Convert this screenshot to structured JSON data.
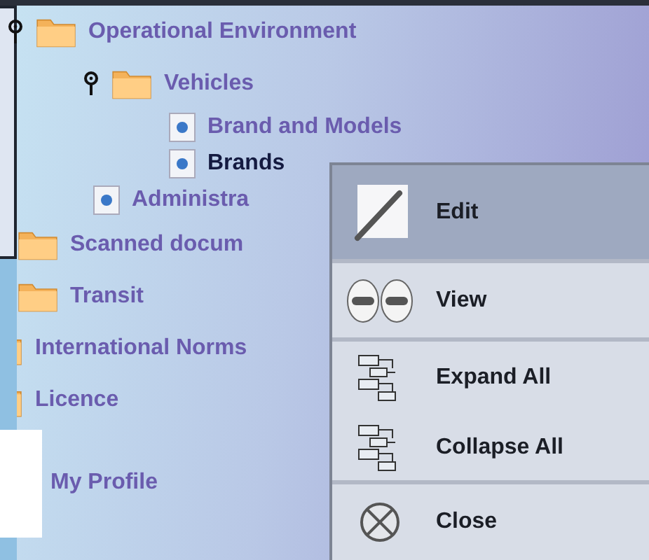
{
  "tree": [
    {
      "label": "Operational Environment",
      "kind": "folder",
      "expanded": true,
      "selected": false,
      "children": [
        {
          "label": "Vehicles",
          "kind": "folder",
          "expanded": true,
          "selected": false,
          "children": [
            {
              "label": "Brand and Models",
              "kind": "document",
              "selected": false
            },
            {
              "label": "Brands",
              "kind": "document",
              "selected": true
            }
          ]
        },
        {
          "label": "Administra",
          "kind": "document",
          "selected": false
        }
      ]
    },
    {
      "label": "Scanned docum",
      "kind": "folder",
      "selected": false
    },
    {
      "label": "Transit",
      "kind": "folder",
      "selected": false
    },
    {
      "label": "International Norms",
      "kind": "clipped",
      "selected": false
    },
    {
      "label": "Licence",
      "kind": "clipped",
      "selected": false
    },
    {
      "label": "My Profile",
      "kind": "profile",
      "selected": false
    }
  ],
  "context_menu": [
    {
      "label": "Edit",
      "kind": "pencil",
      "selected": true
    },
    {
      "label": "View",
      "kind": "eyes",
      "selected": false
    },
    {
      "label": "Expand All",
      "kind": "expand",
      "selected": false
    },
    {
      "label": "Collapse All",
      "kind": "collapse",
      "selected": false
    },
    {
      "label": "Close",
      "kind": "close",
      "selected": false
    }
  ]
}
